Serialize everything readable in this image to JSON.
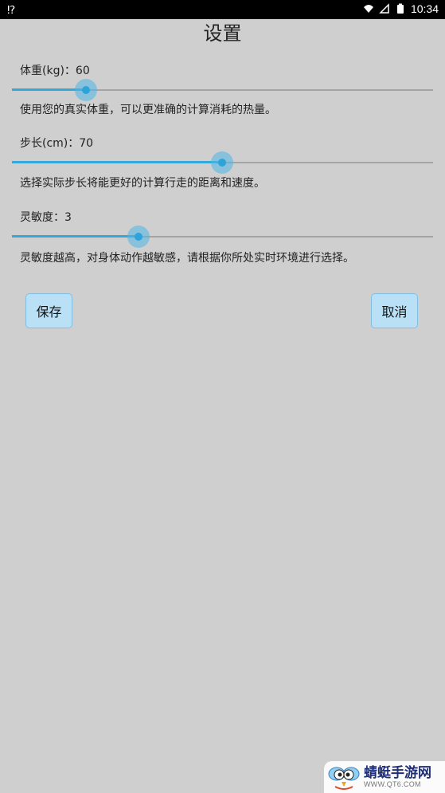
{
  "status_bar": {
    "time": "10:34",
    "icons": [
      "notification-icon",
      "wifi-icon",
      "signal-icon",
      "battery-icon"
    ]
  },
  "page": {
    "title": "设置"
  },
  "settings": {
    "weight": {
      "label": "体重(kg)：60",
      "description": "使用您的真实体重，可以更准确的计算消耗的热量。",
      "value": 60
    },
    "stride": {
      "label": "步长(cm)：70",
      "description": "选择实际步长将能更好的计算行走的距离和速度。",
      "value": 70
    },
    "sensitivity": {
      "label": "灵敏度：3",
      "description": "灵敏度越高，对身体动作越敏感，请根据你所处实时环境进行选择。",
      "value": 3
    }
  },
  "buttons": {
    "save": "保存",
    "cancel": "取消"
  },
  "watermark": {
    "name": "蜻蜓手游网",
    "url": "WWW.QT6.COM"
  },
  "colors": {
    "accent": "#35a8da",
    "button_bg": "#b9e0f5",
    "background": "#cfcfcf"
  }
}
